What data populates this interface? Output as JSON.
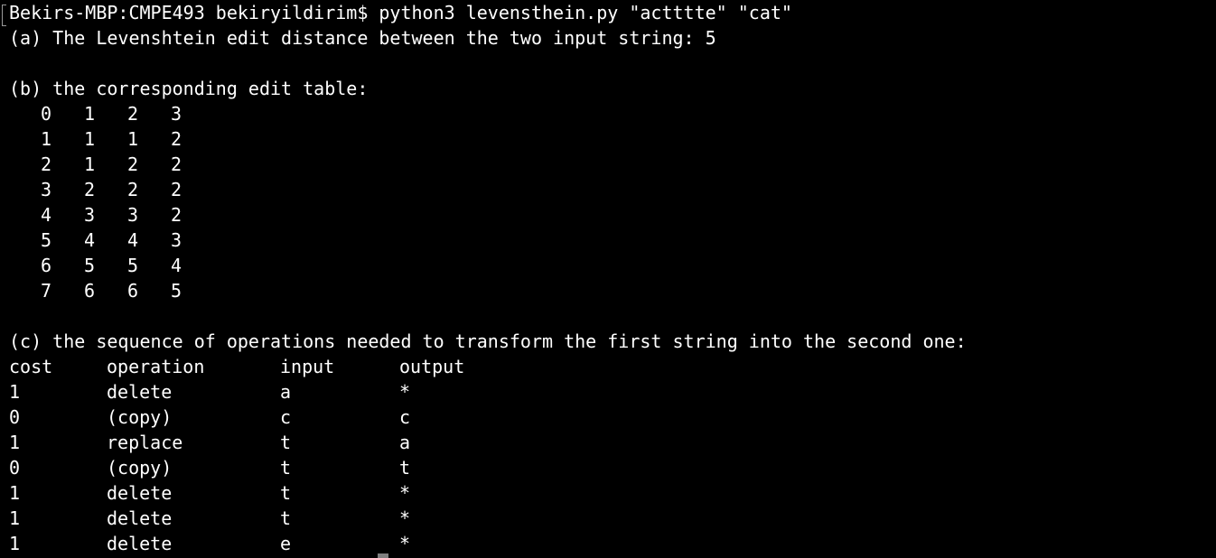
{
  "terminal": {
    "prompt": "Bekirs-MBP:CMPE493 bekiryildirim$ python3 levensthein.py \"actttte\" \"cat\"",
    "line_a": "(a) The Levenshtein edit distance between the two input string: 5",
    "line_b": "(b) the corresponding edit table:",
    "table": [
      [
        "0",
        "1",
        "2",
        "3"
      ],
      [
        "1",
        "1",
        "1",
        "2"
      ],
      [
        "2",
        "1",
        "2",
        "2"
      ],
      [
        "3",
        "2",
        "2",
        "2"
      ],
      [
        "4",
        "3",
        "3",
        "2"
      ],
      [
        "5",
        "4",
        "4",
        "3"
      ],
      [
        "6",
        "5",
        "5",
        "4"
      ],
      [
        "7",
        "6",
        "6",
        "5"
      ]
    ],
    "line_c": "(c) the sequence of operations needed to transform the first string into the second one:",
    "ops_headers": [
      "cost",
      "operation",
      "input",
      "output"
    ],
    "ops": [
      [
        "1",
        "delete",
        "a",
        "*"
      ],
      [
        "0",
        "(copy)",
        "c",
        "c"
      ],
      [
        "1",
        "replace",
        "t",
        "a"
      ],
      [
        "0",
        "(copy)",
        "t",
        "t"
      ],
      [
        "1",
        "delete",
        "t",
        "*"
      ],
      [
        "1",
        "delete",
        "t",
        "*"
      ],
      [
        "1",
        "delete",
        "e",
        "*"
      ]
    ]
  }
}
